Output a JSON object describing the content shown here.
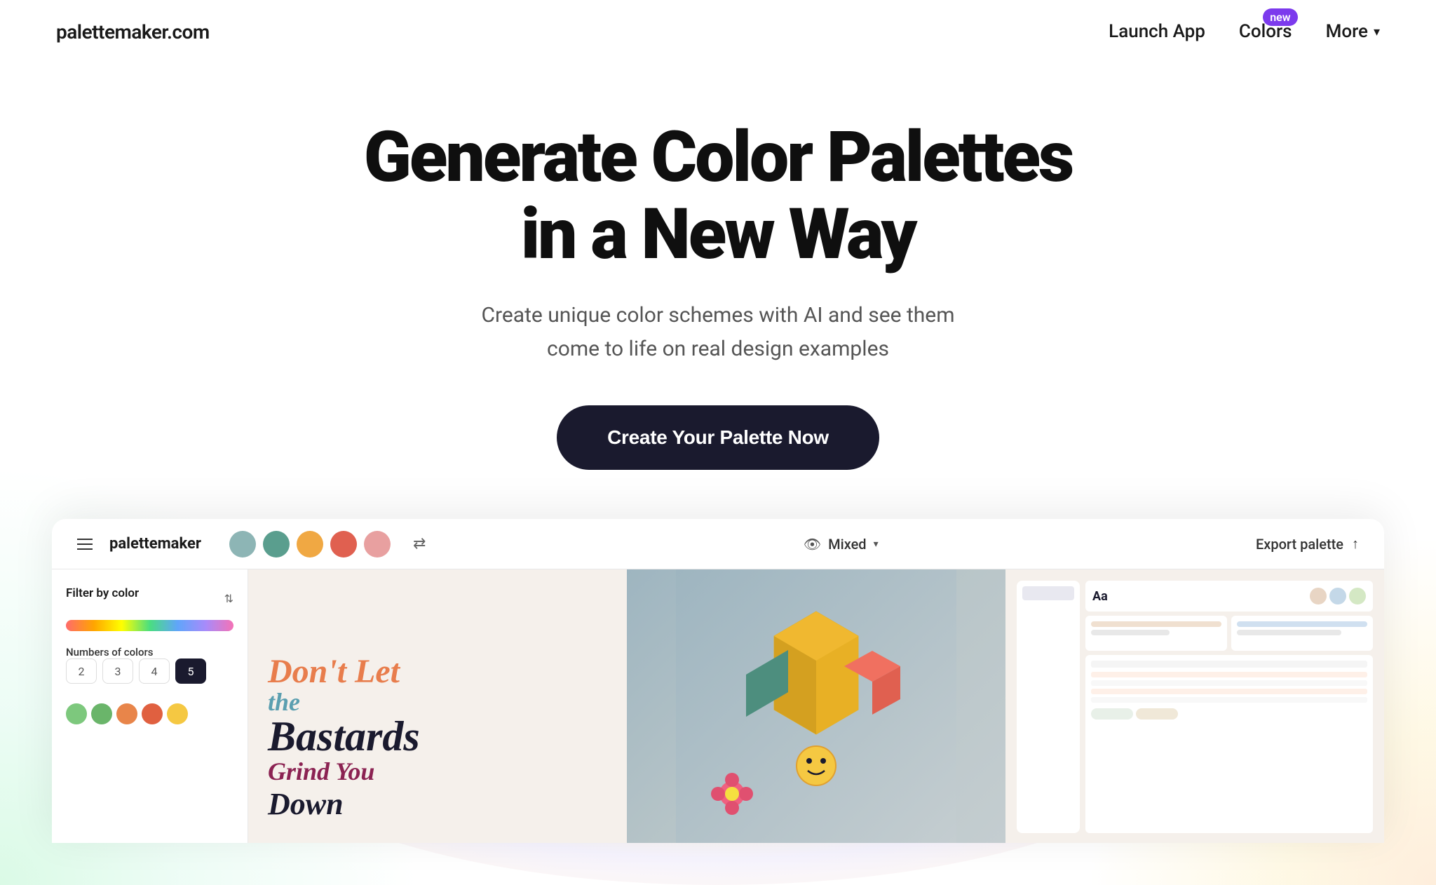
{
  "site": {
    "logo": "palettemaker.com"
  },
  "navbar": {
    "logo": "palettemaker.com",
    "launch_label": "Launch App",
    "colors_label": "Colors",
    "new_badge": "new",
    "more_label": "More",
    "chevron": "▾"
  },
  "hero": {
    "title_line1": "Generate Color Palettes",
    "title_line2": "in a New Way",
    "subtitle": "Create unique color schemes with AI and see them come to life on real design examples",
    "cta_button": "Create Your Palette Now"
  },
  "app_preview": {
    "topbar": {
      "logo": "palettemaker",
      "color_dots": [
        {
          "color": "#8db5b5"
        },
        {
          "color": "#5a9e8e"
        },
        {
          "color": "#f0a843"
        },
        {
          "color": "#e06050"
        },
        {
          "color": "#e8a0a0"
        }
      ],
      "view_mode": "Mixed",
      "export_label": "Export palette"
    },
    "sidebar": {
      "filter_title": "Filter by color",
      "numbers_title": "Numbers of colors",
      "number_options": [
        "2",
        "3",
        "4",
        "5"
      ],
      "active_number": "5"
    }
  }
}
